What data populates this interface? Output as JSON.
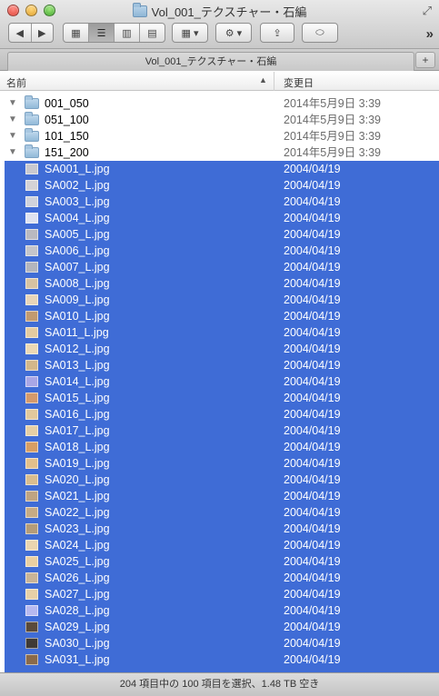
{
  "window": {
    "title": "Vol_001_テクスチャー・石編",
    "icons": {
      "close": "close-icon",
      "minimize": "minimize-icon",
      "zoom": "zoom-icon",
      "fullscreen": "fullscreen-icon"
    }
  },
  "toolbar": {
    "back_glyph": "◀",
    "forward_glyph": "▶",
    "view_icon_glyph": "▦",
    "view_list_glyph": "☰",
    "view_column_glyph": "▥",
    "view_coverflow_glyph": "▤",
    "arrange_glyph": "▦ ▾",
    "action_glyph": "⚙ ▾",
    "share_glyph": "⇪",
    "tag_glyph": "⬭",
    "overflow_glyph": "»"
  },
  "tabbar": {
    "tab_label": "Vol_001_テクスチャー・石編",
    "add_glyph": "+"
  },
  "columns": {
    "name": "名前",
    "date": "変更日",
    "sort_glyph": "▲"
  },
  "folders": [
    {
      "name": "001_050",
      "date": "2014年5月9日 3:39"
    },
    {
      "name": "051_100",
      "date": "2014年5月9日 3:39"
    },
    {
      "name": "101_150",
      "date": "2014年5月9日 3:39"
    },
    {
      "name": "151_200",
      "date": "2014年5月9日 3:39"
    }
  ],
  "files": [
    {
      "name": "SA001_L.jpg",
      "date": "2004/04/19",
      "color": "#c9c9cf"
    },
    {
      "name": "SA002_L.jpg",
      "date": "2004/04/19",
      "color": "#d4d2d6"
    },
    {
      "name": "SA003_L.jpg",
      "date": "2004/04/19",
      "color": "#cfd2dc"
    },
    {
      "name": "SA004_L.jpg",
      "date": "2004/04/19",
      "color": "#dfe3f0"
    },
    {
      "name": "SA005_L.jpg",
      "date": "2004/04/19",
      "color": "#b9b9c0"
    },
    {
      "name": "SA006_L.jpg",
      "date": "2004/04/19",
      "color": "#c4c5cb"
    },
    {
      "name": "SA007_L.jpg",
      "date": "2004/04/19",
      "color": "#b3b5bd"
    },
    {
      "name": "SA008_L.jpg",
      "date": "2004/04/19",
      "color": "#d7c2a2"
    },
    {
      "name": "SA009_L.jpg",
      "date": "2004/04/19",
      "color": "#e8d5b8"
    },
    {
      "name": "SA010_L.jpg",
      "date": "2004/04/19",
      "color": "#c29a70"
    },
    {
      "name": "SA011_L.jpg",
      "date": "2004/04/19",
      "color": "#e4cba1"
    },
    {
      "name": "SA012_L.jpg",
      "date": "2004/04/19",
      "color": "#ecd8b4"
    },
    {
      "name": "SA013_L.jpg",
      "date": "2004/04/19",
      "color": "#d3b78a"
    },
    {
      "name": "SA014_L.jpg",
      "date": "2004/04/19",
      "color": "#a9a6e6"
    },
    {
      "name": "SA015_L.jpg",
      "date": "2004/04/19",
      "color": "#d59a6b"
    },
    {
      "name": "SA016_L.jpg",
      "date": "2004/04/19",
      "color": "#e1c89d"
    },
    {
      "name": "SA017_L.jpg",
      "date": "2004/04/19",
      "color": "#e6cfa5"
    },
    {
      "name": "SA018_L.jpg",
      "date": "2004/04/19",
      "color": "#d79e64"
    },
    {
      "name": "SA019_L.jpg",
      "date": "2004/04/19",
      "color": "#e3bf8b"
    },
    {
      "name": "SA020_L.jpg",
      "date": "2004/04/19",
      "color": "#d9bd8e"
    },
    {
      "name": "SA021_L.jpg",
      "date": "2004/04/19",
      "color": "#bfa482"
    },
    {
      "name": "SA022_L.jpg",
      "date": "2004/04/19",
      "color": "#c7ab85"
    },
    {
      "name": "SA023_L.jpg",
      "date": "2004/04/19",
      "color": "#b59c78"
    },
    {
      "name": "SA024_L.jpg",
      "date": "2004/04/19",
      "color": "#ead5b0"
    },
    {
      "name": "SA025_L.jpg",
      "date": "2004/04/19",
      "color": "#e9cfa2"
    },
    {
      "name": "SA026_L.jpg",
      "date": "2004/04/19",
      "color": "#c9b497"
    },
    {
      "name": "SA027_L.jpg",
      "date": "2004/04/19",
      "color": "#e7d0a8"
    },
    {
      "name": "SA028_L.jpg",
      "date": "2004/04/19",
      "color": "#b7b9f0"
    },
    {
      "name": "SA029_L.jpg",
      "date": "2004/04/19",
      "color": "#5a4a3a"
    },
    {
      "name": "SA030_L.jpg",
      "date": "2004/04/19",
      "color": "#3f3a36"
    },
    {
      "name": "SA031_L.jpg",
      "date": "2004/04/19",
      "color": "#8a6a4a"
    }
  ],
  "status": {
    "text": "204 項目中の 100 項目を選択、1.48 TB 空き"
  },
  "colors": {
    "selection": "#3f6cd6"
  }
}
